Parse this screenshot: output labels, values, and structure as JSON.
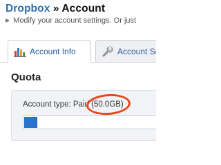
{
  "header": {
    "app_name": "Dropbox",
    "separator": " » ",
    "page_name": "Account",
    "subtitle": "Modify your account settings. Or just"
  },
  "tabs": [
    {
      "label": "Account Info",
      "icon": "bar-chart-icon",
      "active": true
    },
    {
      "label": "Account Settings",
      "icon": "wrench-icon",
      "active": false
    }
  ],
  "quota": {
    "section_title": "Quota",
    "account_type_label": "Account type: Paid",
    "account_type_value": "(50.0GB)",
    "usage_fraction": 0.085,
    "bar_fill_color": "#2a74c9",
    "annotation_color": "#e8471b"
  }
}
